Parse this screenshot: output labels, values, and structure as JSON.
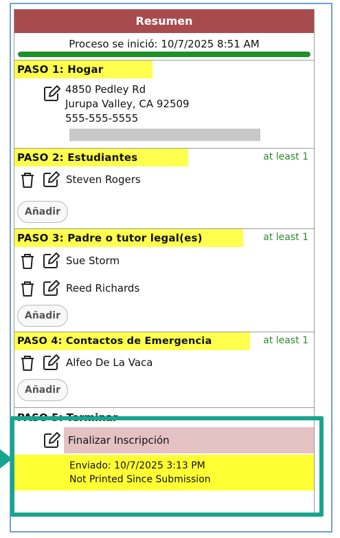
{
  "summary": {
    "title": "Resumen",
    "started": "Proceso se inició: 10/7/2025 8:51 AM",
    "progress_fraction": 1.0
  },
  "step1": {
    "title": "PASO 1: Hogar",
    "address_line1": "4850 Pedley Rd",
    "address_line2": "Jurupa Valley, CA 92509",
    "phone": "555-555-5555"
  },
  "step2": {
    "title": "PASO 2: Estudiantes",
    "requirement": "at least 1",
    "people": [
      "Steven Rogers"
    ],
    "add_label": "Añadir"
  },
  "step3": {
    "title": "PASO 3: Padre o tutor legal(es)",
    "requirement": "at least 1",
    "people": [
      "Sue Storm",
      "Reed Richards"
    ],
    "add_label": "Añadir"
  },
  "step4": {
    "title": "PASO 4: Contactos de Emergencia",
    "requirement": "at least 1",
    "people": [
      "Alfeo De La Vaca"
    ],
    "add_label": "Añadir"
  },
  "step5": {
    "title": "PASO 5: Terminar",
    "finalize_label": "Finalizar Inscripción",
    "submitted": "Enviado: 10/7/2025 3:13 PM",
    "print_status": "Not Printed Since Submission"
  },
  "colors": {
    "header": "#a84b4f",
    "step_highlight": "#ffff4d",
    "requirement": "#2b8a2b",
    "callout": "#18a58f",
    "finalize_bg": "#e4c2c4"
  },
  "icons": {
    "edit": "pencil-square-icon",
    "delete": "trash-icon",
    "arrow": "callout-arrow"
  }
}
